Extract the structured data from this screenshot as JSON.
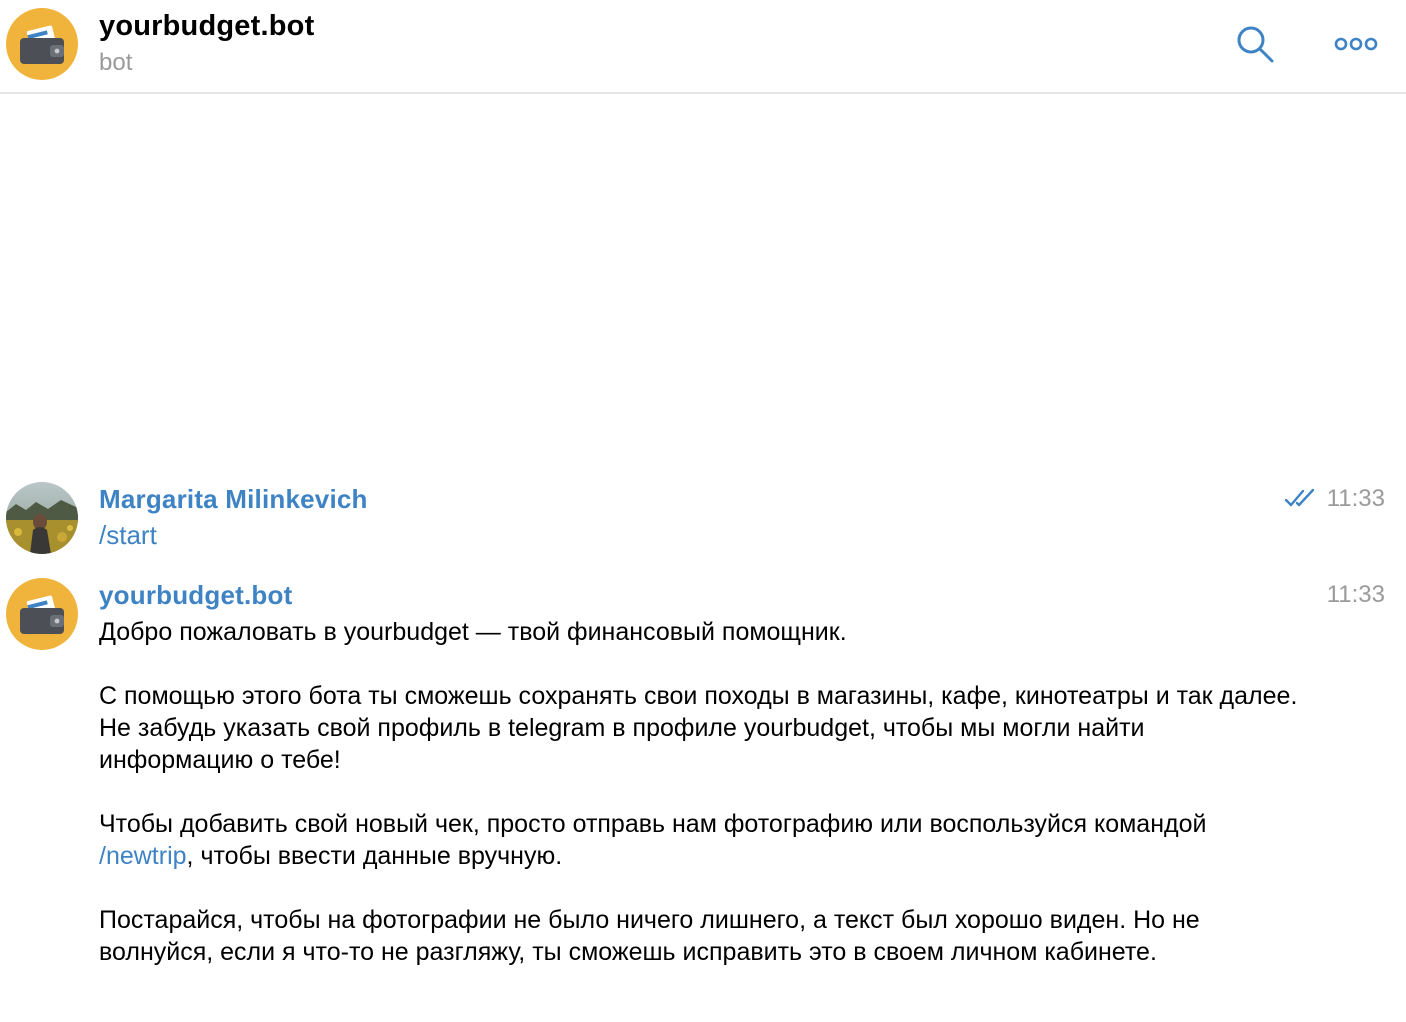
{
  "header": {
    "title": "yourbudget.bot",
    "subtitle": "bot",
    "accent_color": "#3e83c4",
    "avatar_color": "#f0b43c",
    "search_icon": "search-icon",
    "more_icon": "more-icon"
  },
  "messages": [
    {
      "sender": "Margarita Milinkevich",
      "time": "11:33",
      "status": "read",
      "text": "/start"
    },
    {
      "sender": "yourbudget.bot",
      "time": "11:33",
      "paragraphs": {
        "p1": "Добро пожаловать в yourbudget — твой финансовый помощник.",
        "p2": "С помощью этого бота ты сможешь сохранять свои походы в магазины, кафе, кинотеатры и так далее. Не забудь указать свой профиль в telegram в профиле yourbudget, чтобы мы могли найти информацию о тебе!",
        "p3_before": "Чтобы добавить свой новый чек, просто отправь нам фотографию или воспользуйся командой ",
        "p3_link": "/newtrip",
        "p3_after": ", чтобы ввести данные вручную.",
        "p4": "Постарайся, чтобы на фотографии не было ничего лишнего, а текст был хорошо виден. Но не волнуйся, если я что-то не разгляжу, ты сможешь исправить это в своем личном кабинете."
      }
    }
  ]
}
